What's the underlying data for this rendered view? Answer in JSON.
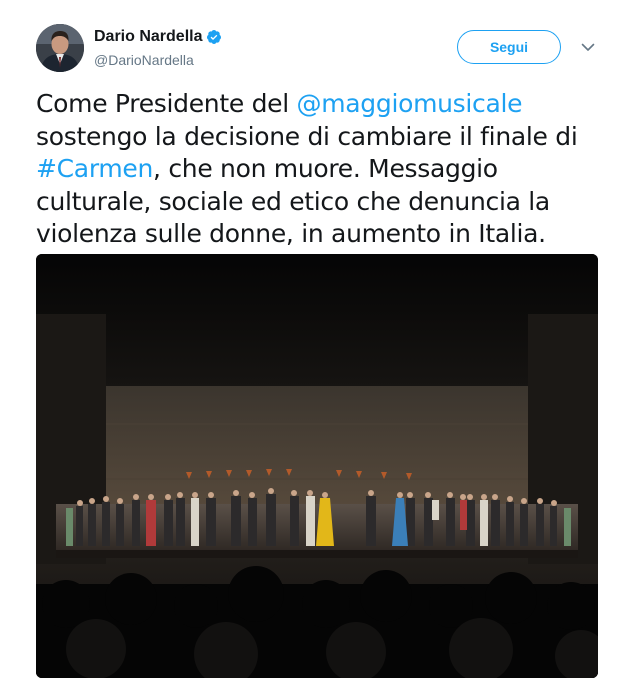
{
  "user": {
    "display_name": "Dario Nardella",
    "handle": "@DarioNardella",
    "verified_icon": "verified-badge-icon",
    "verified_color": "#1da1f2"
  },
  "actions": {
    "follow_label": "Segui",
    "caret_icon": "chevron-down-icon"
  },
  "tweet": {
    "line1_prefix": "Come Presidente del ",
    "mention": "@maggiomusicale",
    "line2": "sostengo la decisione di cambiare il finale di",
    "hashtag": "#Carmen",
    "line3_suffix": ", che non muore. Messaggio",
    "line4": "culturale, sociale ed etico che denuncia la",
    "line5": "violenza sulle donne, in aumento in Italia."
  },
  "media": {
    "type": "photo",
    "subject": "opera-curtain-call-photo"
  },
  "colors": {
    "link": "#1da1f2",
    "text": "#14171a",
    "secondary": "#657786"
  }
}
